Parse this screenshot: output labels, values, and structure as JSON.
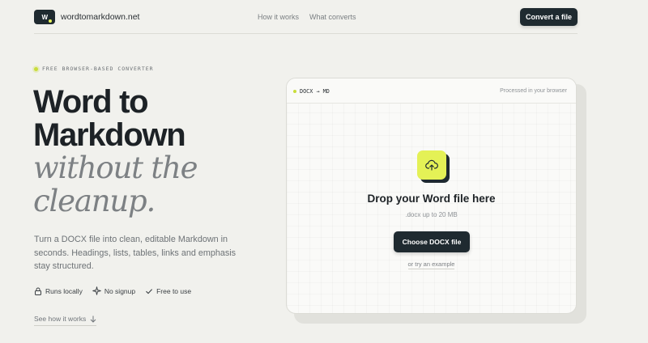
{
  "header": {
    "logo_glyph": "W",
    "brand": "wordtomarkdown.net",
    "nav": [
      {
        "label": "How it works"
      },
      {
        "label": "What converts"
      }
    ],
    "cta_label": "Convert a file"
  },
  "hero": {
    "eyebrow": "FREE BROWSER-BASED CONVERTER",
    "headline_line1": "Word to",
    "headline_line2": "Markdown",
    "headline_line3": "without the",
    "headline_line4": "cleanup.",
    "description": "Turn a DOCX file into clean, editable Markdown in seconds. Headings, lists, tables, links and emphasis stay structured.",
    "features": [
      {
        "icon": "lock-icon",
        "label": "Runs locally"
      },
      {
        "icon": "sparkle-icon",
        "label": "No signup"
      },
      {
        "icon": "check-icon",
        "label": "Free to use"
      }
    ],
    "see_how_label": "See how it works",
    "see_how_icon": "arrow-down-icon"
  },
  "converter": {
    "tag": "DOCX → MD",
    "note": "Processed in your browser",
    "icon": "upload-cloud-icon",
    "drop_title": "Drop your Word file here",
    "limit": ".docx up to 20 MB",
    "choose_label": "Choose DOCX file",
    "try_example": "or try an example"
  },
  "colors": {
    "background": "#f1f1ed",
    "dark": "#1f2a30",
    "accent": "#e4f156",
    "muted_text": "#7d8184"
  }
}
